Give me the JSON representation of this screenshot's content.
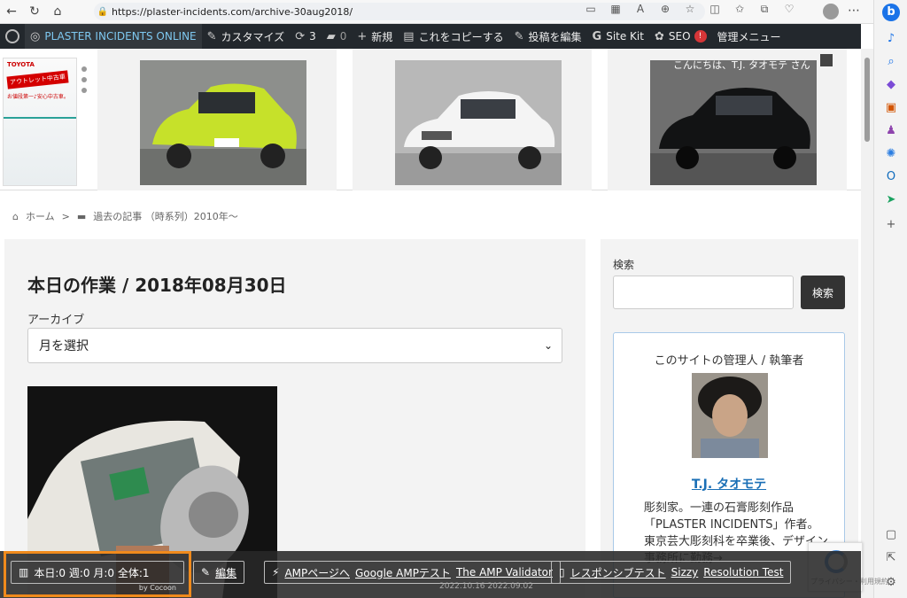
{
  "browser": {
    "url": "https://plaster-incidents.com/archive-30aug2018/"
  },
  "adminbar": {
    "site_name": "PLASTER INCIDENTS ONLINE",
    "customize": "カスタマイズ",
    "updates_count": "3",
    "comments_count": "0",
    "new": "新規",
    "copy": "これをコピーする",
    "edit_post": "投稿を編集",
    "site_kit": "Site Kit",
    "seo": "SEO",
    "seo_badge": "!",
    "admin_menu": "管理メニュー"
  },
  "banner": {
    "ad_maker": "TOYOTA",
    "ad_tag": "アウトレット中古車",
    "ad_sub": "お値段第一♪安心中古車。",
    "greeting": "こんにちは、T.J. タオモテ さん"
  },
  "breadcrumb": {
    "home": "ホーム",
    "separator": ">",
    "category": "過去の記事 （時系列）2010年～"
  },
  "main": {
    "title": "本日の作業 / 2018年08月30日",
    "archive_label": "アーカイブ",
    "select_value": "月を選択"
  },
  "sidebar": {
    "search_label": "検索",
    "search_button": "検索",
    "profile_title": "このサイトの管理人 / 執筆者",
    "profile_name": "T.J. タオモテ",
    "profile_bio": "彫刻家。一連の石膏彫刻作品「PLASTER INCIDENTS」作者。東京芸大彫刻科を卒業後、デザイン事務所に勤務→"
  },
  "toolbar": {
    "stats": "本日:0 週:0 月:0 全体:1",
    "by": "by Cocoon",
    "edit": "編集",
    "amp_page": "AMPページへ",
    "google_amp": "Google AMPテスト",
    "amp_validator": "The AMP Validator",
    "responsive": "レスポンシブテスト",
    "sizzy": "Sizzy",
    "resolution": "Resolution Test",
    "dates": "2022.10.16  2022.09.02"
  },
  "recaptcha": {
    "text": "プライバシー・利用規約"
  },
  "colors": {
    "adminbar": "#23282d",
    "link": "#1a6fb6",
    "highlight": "#f08a1c"
  }
}
